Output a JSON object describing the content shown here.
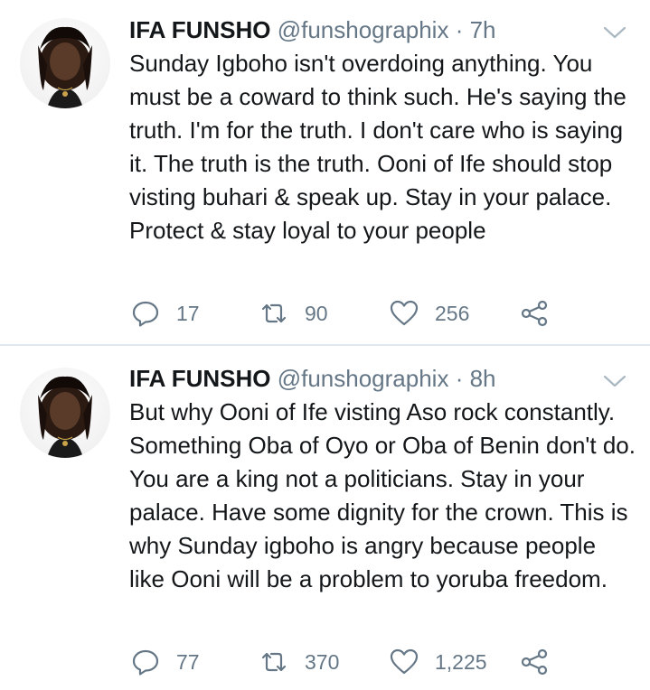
{
  "tweets": [
    {
      "name": "IFA FUNSHO",
      "handle": "@funshographix",
      "separator": "·",
      "time": "7h",
      "text": "Sunday Igboho isn't overdoing anything. You must be a coward to think such. He's saying the truth. I'm for the truth. I don't care who is saying it. The truth is the truth. Ooni of Ife should stop visting buhari & speak up. Stay in your palace. Protect & stay loyal to your people",
      "replies": "17",
      "retweets": "90",
      "likes": "256"
    },
    {
      "name": "IFA FUNSHO",
      "handle": "@funshographix",
      "separator": "·",
      "time": "8h",
      "text": "But why Ooni of Ife visting Aso rock constantly. Something Oba of Oyo or Oba of Benin don't do. You are a king not a politicians. Stay in your palace. Have some dignity for the crown. This is why Sunday igboho is angry because people like Ooni will be a problem to yoruba freedom.",
      "replies": "77",
      "retweets": "370",
      "likes": "1,225"
    }
  ],
  "icons": {
    "reply": "reply-icon",
    "retweet": "retweet-icon",
    "like": "heart-icon",
    "share": "share-icon",
    "menu": "chevron-down-icon"
  },
  "colors": {
    "text": "#14171a",
    "secondary": "#657786",
    "divider": "#e1e8ed"
  }
}
